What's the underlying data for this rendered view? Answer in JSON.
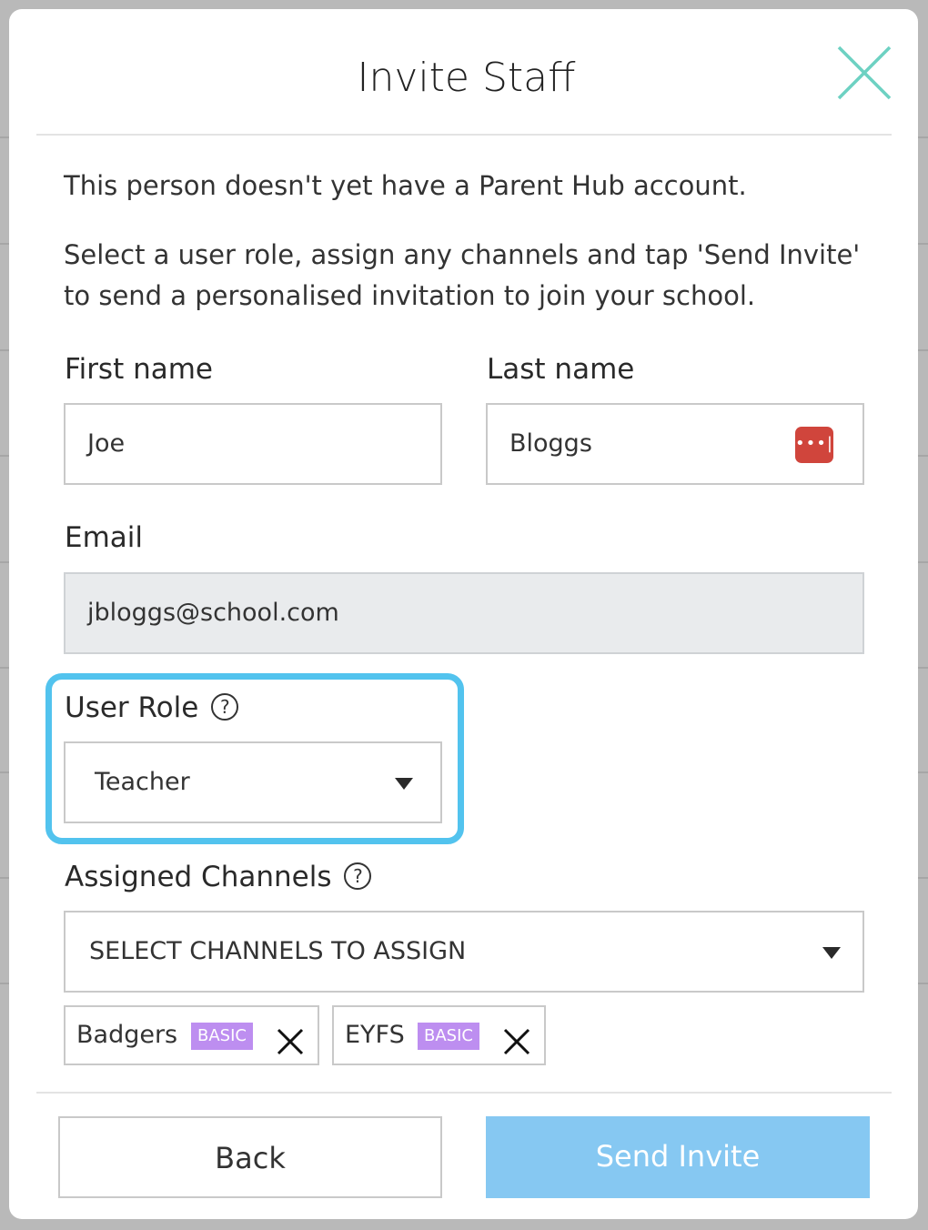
{
  "modal": {
    "title": "Invite Staff",
    "intro": "This person doesn't yet have a Parent Hub account.",
    "instructions": "Select a user role, assign any channels and tap 'Send Invite' to send a personalised invitation to join your school."
  },
  "form": {
    "first_name": {
      "label": "First name",
      "value": "Joe"
    },
    "last_name": {
      "label": "Last name",
      "value": "Bloggs"
    },
    "email": {
      "label": "Email",
      "value": "jbloggs@school.com"
    },
    "user_role": {
      "label": "User Role",
      "selected": "Teacher"
    },
    "assigned_channels": {
      "label": "Assigned Channels",
      "placeholder": "SELECT CHANNELS TO ASSIGN",
      "chips": [
        {
          "name": "Badgers",
          "badge": "BASIC"
        },
        {
          "name": "EYFS",
          "badge": "BASIC"
        }
      ]
    }
  },
  "buttons": {
    "back": "Back",
    "send": "Send Invite"
  },
  "icons": {
    "close": "close-icon",
    "password_manager": "password-manager-icon",
    "help": "help-icon",
    "dropdown": "chevron-down-icon",
    "remove": "remove-icon"
  },
  "colors": {
    "highlight": "#52c3ee",
    "close_icon": "#6dd1c2",
    "send_button": "#86c8f2",
    "badge": "#bd8ef0",
    "password_icon": "#d0453c"
  }
}
